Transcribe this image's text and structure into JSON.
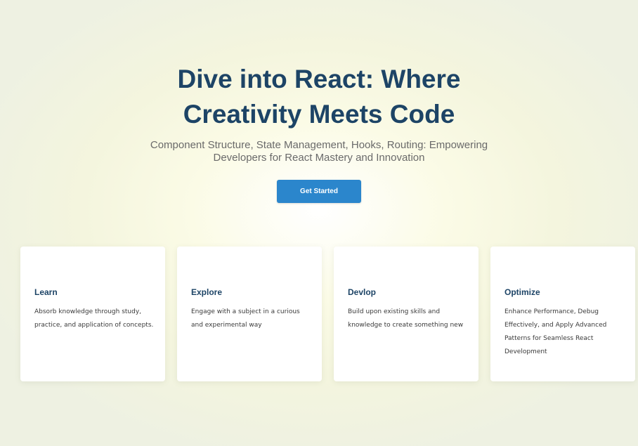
{
  "hero": {
    "title": "Dive into React: Where Creativity Meets Code",
    "subtitle": "Component Structure, State Management, Hooks, Routing: Empowering Developers for React Mastery and Innovation",
    "cta_label": "Get Started"
  },
  "cards": [
    {
      "title": "Learn",
      "text": "Absorb knowledge through study, practice, and application of concepts."
    },
    {
      "title": "Explore",
      "text": "Engage with a subject in a curious and experimental way"
    },
    {
      "title": "Devlop",
      "text": "Build upon existing skills and knowledge to create something new"
    },
    {
      "title": "Optimize",
      "text": "Enhance Performance, Debug Effectively, and Apply Advanced Patterns for Seamless React Development"
    }
  ],
  "colors": {
    "heading": "#1d4466",
    "accent": "#2b86cc",
    "background": "#f4f5de",
    "card": "#ffffff"
  }
}
